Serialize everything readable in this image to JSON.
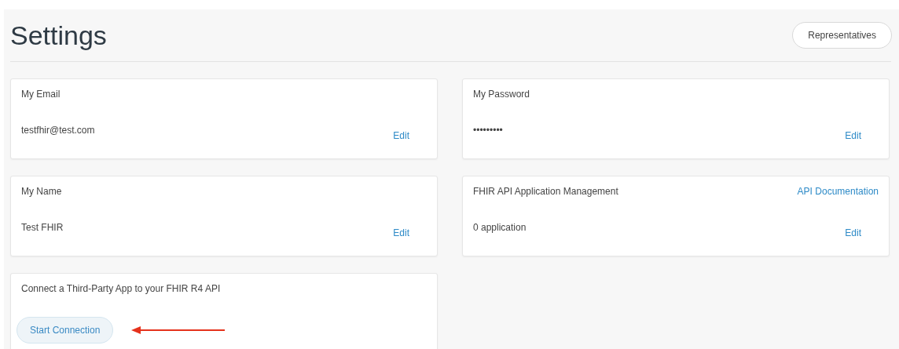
{
  "page": {
    "title": "Settings",
    "header_button": "Representatives"
  },
  "cards": [
    {
      "kind": "field",
      "title": "My Email",
      "value": "testfhir@test.com",
      "action": "Edit"
    },
    {
      "kind": "field",
      "title": "My Password",
      "value": "•••••••••",
      "action": "Edit"
    },
    {
      "kind": "field",
      "title": "My Name",
      "value": "Test FHIR",
      "action": "Edit"
    },
    {
      "kind": "field",
      "title": "FHIR API Application Management",
      "link": "API Documentation",
      "value": "0 application",
      "action": "Edit"
    },
    {
      "kind": "connect",
      "title": "Connect a Third-Party App to your FHIR R4 API",
      "button": "Start Connection",
      "annotation": {
        "kind": "arrow"
      }
    }
  ]
}
